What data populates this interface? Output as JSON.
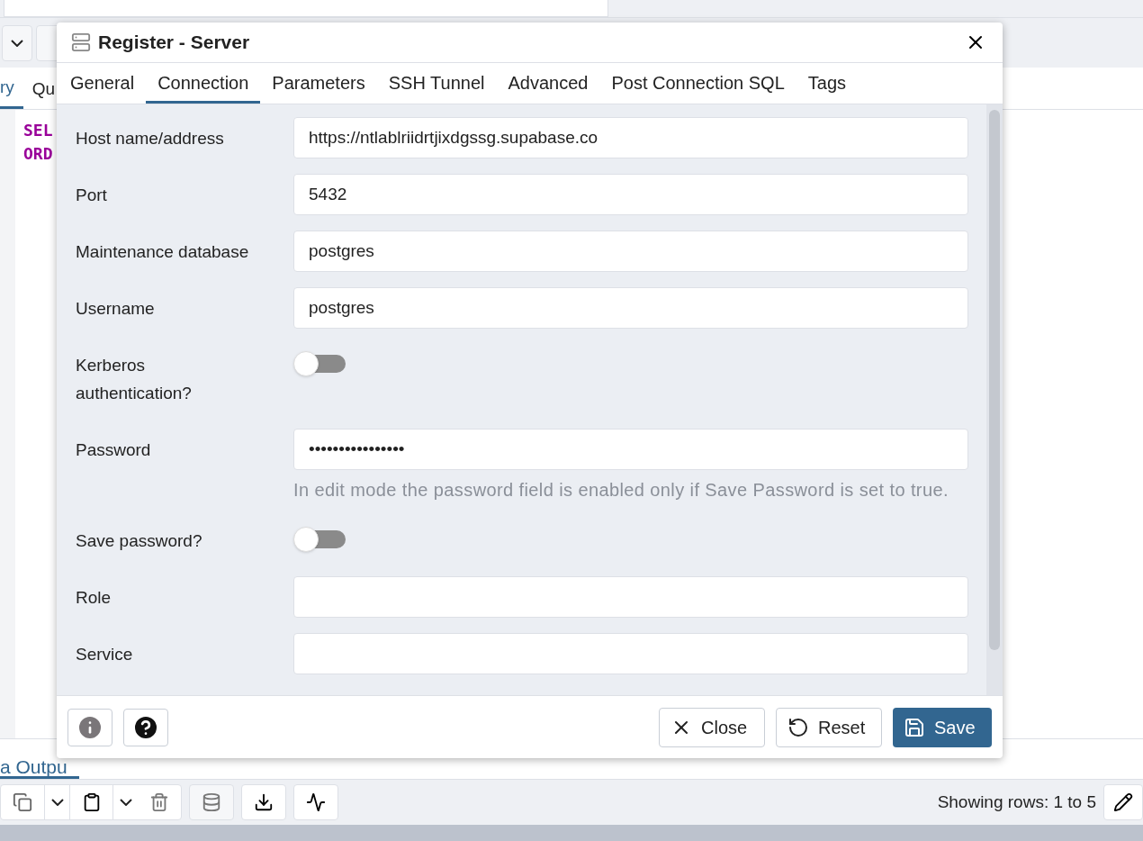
{
  "background": {
    "editor_tabs": [
      {
        "label": "ry",
        "selected": true
      },
      {
        "label": "Qu",
        "selected": false
      }
    ],
    "sql_lines": [
      "SEL",
      "ORD"
    ],
    "result_tabs": [
      {
        "label": "a Outpu",
        "selected": true
      }
    ],
    "rows_info": "Showing rows: 1 to 5"
  },
  "dialog": {
    "title": "Register - Server",
    "tabs": [
      {
        "label": "General",
        "selected": false
      },
      {
        "label": "Connection",
        "selected": true
      },
      {
        "label": "Parameters",
        "selected": false
      },
      {
        "label": "SSH Tunnel",
        "selected": false
      },
      {
        "label": "Advanced",
        "selected": false
      },
      {
        "label": "Post Connection SQL",
        "selected": false
      },
      {
        "label": "Tags",
        "selected": false
      }
    ],
    "fields": [
      {
        "kind": "text",
        "label": "Host name/address",
        "value": "https://ntlablriidrtjixdgssg.supabase.co"
      },
      {
        "kind": "text",
        "label": "Port",
        "value": "5432"
      },
      {
        "kind": "text",
        "label": "Maintenance database",
        "value": "postgres"
      },
      {
        "kind": "text",
        "label": "Username",
        "value": "postgres"
      },
      {
        "kind": "toggle",
        "label": "Kerberos authentication?",
        "on": false
      },
      {
        "kind": "password",
        "label": "Password",
        "value": "••••••••••••••••",
        "help": "In edit mode the password field is enabled only if Save Password is set to true."
      },
      {
        "kind": "toggle",
        "label": "Save password?",
        "on": false
      },
      {
        "kind": "text",
        "label": "Role"
      },
      {
        "kind": "text",
        "label": "Service"
      }
    ],
    "buttons": [
      {
        "kind": "close",
        "label": "Close"
      },
      {
        "kind": "reset",
        "label": "Reset"
      },
      {
        "kind": "save",
        "label": "Save"
      }
    ]
  }
}
